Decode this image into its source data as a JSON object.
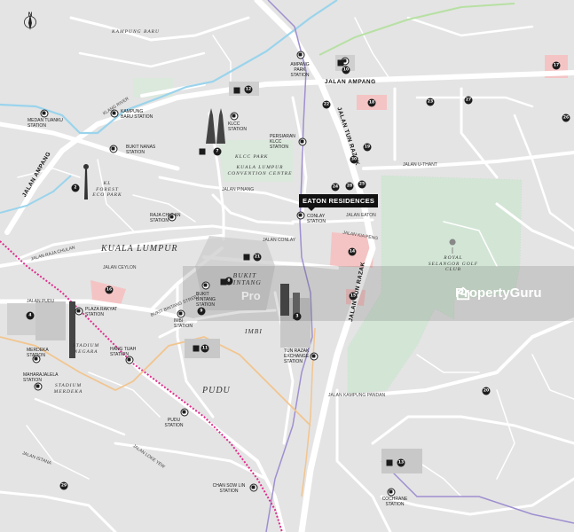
{
  "map": {
    "north_label": "N",
    "highlight": "EATON RESIDENCES",
    "areas": {
      "kampung_baru": "KAMPUNG BARU",
      "kuala_lumpur": "KUALA LUMPUR",
      "bukit_bintang": "BUKIT BINTANG",
      "imbi": "IMBI",
      "pudu": "PUDU",
      "stadium_negara": "STADIUM NEGARA",
      "stadium_merdeka": "STADIUM MERDEKA",
      "klcc_park": "KLCC PARK",
      "kl_convention": "KUALA LUMPUR CONVENTION CENTRE",
      "kl_forest": "KL FOREST ECO PARK",
      "golf": "ROYAL SELANGOR GOLF CLUB"
    },
    "roads": {
      "jalan_ampang": "JALAN AMPANG",
      "jalan_tun_razak": "JALAN TUN RAZAK",
      "jalan_ampang_left": "JALAN AMPANG",
      "jalan_u_thant": "JALAN U-THANT",
      "jalan_pinang": "JALAN PINANG",
      "jalan_conlay": "JALAN CONLAY",
      "jalan_eaton": "JALAN EATON",
      "jalan_kia_peng": "JALAN KIA PENG",
      "jalan_raja_chulan": "JALAN RAJA CHULAN",
      "jalan_ceylon": "JALAN CEYLON",
      "jalan_pudu": "JALAN PUDU",
      "jalan_kampung_pandan": "JALAN KAMPUNG PANDAN",
      "jalan_istana": "JALAN ISTANA",
      "jalan_loke_yew": "JALAN LOKE YEW",
      "jalan_bukit_bintang": "BUKIT BINTANG STREET",
      "klang_river": "KLANG RIVER",
      "jalan_tun_razak_top": "JALAN TUN RAZAK"
    },
    "stations": {
      "medan_tuanku": "MEDAN TUANKU STATION",
      "kampung_baru_stn": "KAMPUNG BARU STATION",
      "bukit_nanas": "BUKIT NANAS STATION",
      "klcc": "KLCC STATION",
      "ampang_park": "AMPANG PARK STATION",
      "persiaran_klcc": "PERSIARAN KLCC STATION",
      "raja_chulan": "RAJA CHULAN STATION",
      "conlay": "CONLAY STATION",
      "bukit_bintang_stn": "BUKIT BINTANG STATION",
      "imbi_stn": "IMBI STATION",
      "plaza_rakyat": "PLAZA RAKYAT STATION",
      "hang_tuah": "HANG TUAH STATION",
      "merdeka": "MERDEKA STATION",
      "maharajalela": "MAHARAJALELA STATION",
      "tun_razak_exchange": "TUN RAZAK EXCHANGE STATION",
      "pudu_stn": "PUDU STATION",
      "chan_sow_lin": "CHAN SOW LIN STATION",
      "cochrane": "COCHRANE STATION"
    },
    "badges": [
      "17",
      "18",
      "23",
      "27",
      "26",
      "22",
      "25",
      "28",
      "24",
      "19",
      "14",
      "16",
      "15",
      "2",
      "4",
      "7",
      "8",
      "9",
      "10",
      "11",
      "12",
      "13",
      "3",
      "21",
      "20",
      "29",
      "30"
    ],
    "watermark": "PropertyGuru",
    "watermark_faint": "Pro"
  },
  "colors": {
    "background": "#e4e4e4",
    "road": "#ffffff",
    "park": "#dbe8dc",
    "golf": "#d3e6d6",
    "river": "#9ad4ec",
    "rail_green": "#b7e0a3",
    "rail_magenta": "#e02b8e",
    "rail_purple": "#9f8fd0",
    "rail_orange": "#f2c58f",
    "highlight_pink": "#f4c4c4",
    "building_dark": "#444444"
  }
}
